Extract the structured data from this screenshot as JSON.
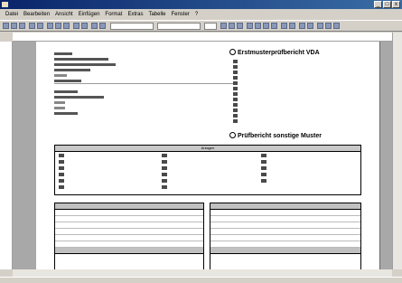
{
  "window": {
    "title": "",
    "buttons": [
      "_",
      "□",
      "x"
    ]
  },
  "menubar": {
    "items": [
      "Datei",
      "Bearbeiten",
      "Ansicht",
      "Einfügen",
      "Format",
      "Extras",
      "Tabelle",
      "Fenster",
      "?"
    ]
  },
  "toolbar": {
    "style_select": "",
    "font_select": "",
    "size_select": ""
  },
  "statusbar": {
    "text": ""
  },
  "document": {
    "address_block": [
      "",
      "",
      "",
      "",
      "",
      "",
      "",
      "",
      "",
      ""
    ],
    "section1": {
      "title": "Erstmusterprüfbericht VDA",
      "checkbox_labels": [
        "",
        "",
        "",
        "",
        "",
        "",
        "",
        "",
        "",
        "",
        "",
        ""
      ]
    },
    "section2": {
      "title": "Prüfbericht sonstige Muster",
      "grid_header": "Anlagen",
      "items": [
        "",
        "",
        "",
        "",
        "",
        "",
        "",
        "",
        "",
        "",
        "",
        "",
        "",
        "",
        "",
        "",
        ""
      ]
    },
    "table_left": {
      "header": "",
      "rows": [
        [
          "",
          ""
        ],
        [
          "",
          ""
        ],
        [
          "",
          ""
        ],
        [
          "",
          ""
        ],
        [
          "",
          ""
        ],
        [
          "",
          ""
        ]
      ],
      "header2": ""
    },
    "table_right": {
      "header": "",
      "rows": [
        [
          "",
          ""
        ],
        [
          "",
          ""
        ],
        [
          "",
          ""
        ],
        [
          "",
          ""
        ],
        [
          "",
          ""
        ],
        [
          "",
          ""
        ]
      ],
      "header2": ""
    }
  },
  "colors": {
    "titlebar_start": "#0a246a",
    "titlebar_end": "#3a6ea5",
    "chrome": "#d4d0c8",
    "workspace": "#a8a8a8"
  }
}
